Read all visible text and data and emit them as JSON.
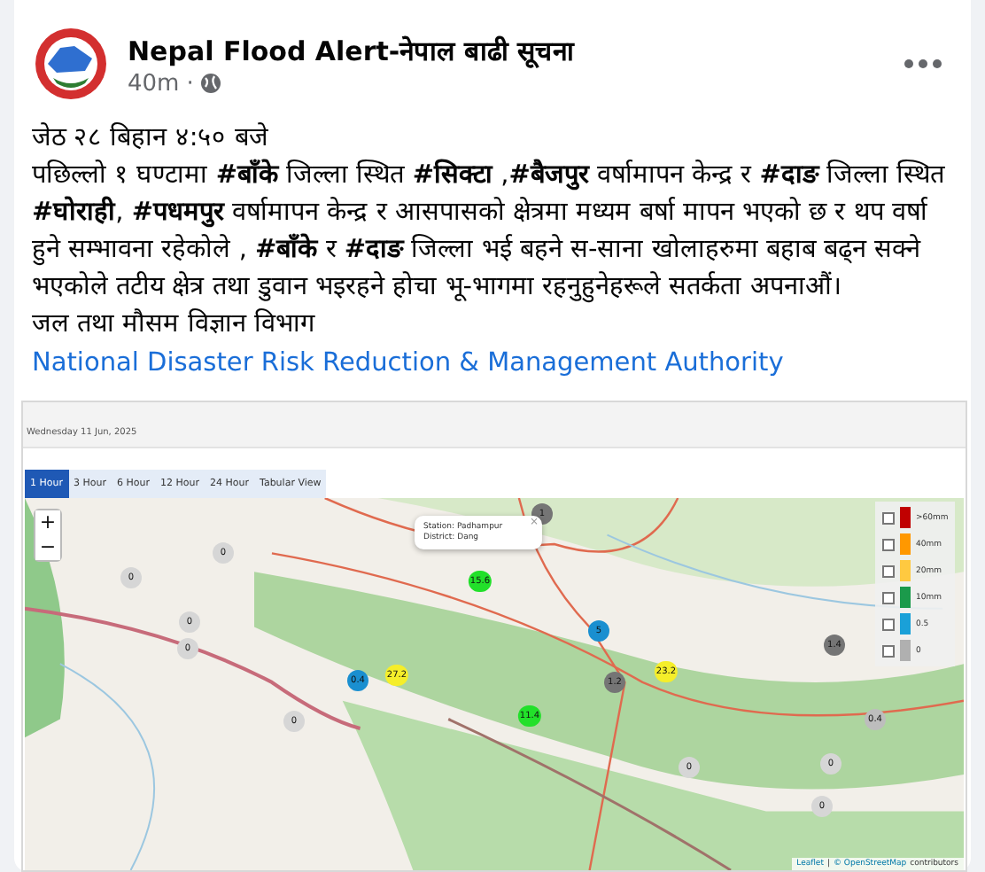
{
  "post": {
    "author": "Nepal Flood Alert-नेपाल बाढी सूचना",
    "time": "40m",
    "separator": "·",
    "lines": [
      "जेठ २८  बिहान ४:५० बजे",
      "पछिल्लो १ घण्टामा **#बाँके** जिल्ला स्थित **#सिक्टा** ,**#बैजपुर** वर्षामापन केन्द्र र **#दाङ** जिल्ला स्थित **#घोराही**, **#पधमपुर** वर्षामापन केन्द्र र आसपासको क्षेत्रमा मध्यम बर्षा मापन भएको छ र थप वर्षा हुने सम्भावना रहेकोले , **#बाँके** र **#दाङ** जिल्ला भई बहने स-साना खोलाहरुमा बहाब बढ्न सक्ने भएकोले तटीय क्षेत्र तथा डुवान भइरहने होचा भू-भागमा रहनुहुनेहरूले सतर्कता अपनाऔं।",
      "जल तथा मौसम विज्ञान विभाग"
    ],
    "link": "National Disaster Risk Reduction & Management Authority"
  },
  "embed": {
    "date": "Wednesday 11 Jun, 2025",
    "tabs": [
      {
        "label": "1 Hour",
        "selected": true
      },
      {
        "label": "3 Hour",
        "selected": false
      },
      {
        "label": "6 Hour",
        "selected": false
      },
      {
        "label": "12 Hour",
        "selected": false
      },
      {
        "label": "24 Hour",
        "selected": false
      },
      {
        "label": "Tabular View",
        "selected": false
      }
    ],
    "zoom": [
      "+",
      "−"
    ],
    "popup": {
      "station": "Station: Padhampur",
      "district": "District: Dang",
      "close": "×"
    },
    "markers": [
      {
        "value": "1",
        "color": "#757575"
      },
      {
        "value": "15.6",
        "color": "#22e02a"
      },
      {
        "value": "5",
        "color": "#1a8fd0"
      },
      {
        "value": "1.4",
        "color": "#757575"
      },
      {
        "value": "0.4",
        "color": "#1a8fd0"
      },
      {
        "value": "27.2",
        "color": "#f5ee2a"
      },
      {
        "value": "1.2",
        "color": "#757575"
      },
      {
        "value": "23.2",
        "color": "#f5ee2a"
      },
      {
        "value": "11.4",
        "color": "#22e02a"
      },
      {
        "value": "0.4",
        "color": "#bdbdbd"
      },
      {
        "value": "0",
        "color": "#d6d6d6"
      },
      {
        "value": "0",
        "color": "#d6d6d6"
      },
      {
        "value": "0",
        "color": "#d6d6d6"
      },
      {
        "value": "0",
        "color": "#d6d6d6"
      },
      {
        "value": "0",
        "color": "#d6d6d6"
      },
      {
        "value": "0",
        "color": "#d6d6d6"
      },
      {
        "value": "0",
        "color": "#d6d6d6"
      },
      {
        "value": "0",
        "color": "#d6d6d6"
      }
    ],
    "legend": [
      {
        "label": ">60mm",
        "color": "#c00000",
        "checked": false
      },
      {
        "label": "40mm",
        "color": "#ff9800",
        "checked": false
      },
      {
        "label": "20mm",
        "color": "#ffc940",
        "checked": false
      },
      {
        "label": "10mm",
        "color": "#1b9a4b",
        "checked": false
      },
      {
        "label": "0.5",
        "color": "#1aa0d8",
        "checked": false
      },
      {
        "label": "0",
        "color": "#b0b0b0",
        "checked": false
      }
    ],
    "attribution": {
      "leaflet": "Leaflet",
      "sep": "|",
      "osm": "© OpenStreetMap",
      "rest": "contributors"
    }
  }
}
